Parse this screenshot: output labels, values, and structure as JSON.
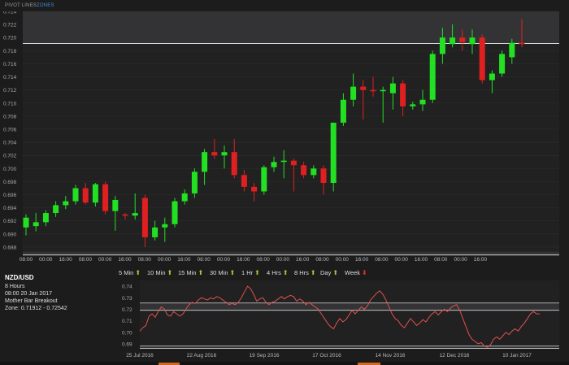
{
  "tabs": {
    "pivot_lines": "PIVOT LINES",
    "zones": "ZONES"
  },
  "info": {
    "pair": "NZD/USD",
    "interval": "8 Hours",
    "time": "08:00 20 Jan 2017",
    "pattern": "Mother Bar Breakout",
    "zone": "Zone: 0.71912 - 0.72542"
  },
  "timeframes": [
    {
      "label": "5 Min",
      "dir": "up"
    },
    {
      "label": "10 Min",
      "dir": "up"
    },
    {
      "label": "15 Min",
      "dir": "up"
    },
    {
      "label": "30 Min",
      "dir": "up"
    },
    {
      "label": "1 Hr",
      "dir": "up"
    },
    {
      "label": "4 Hrs",
      "dir": "up"
    },
    {
      "label": "8 Hrs",
      "dir": "up"
    },
    {
      "label": "Day",
      "dir": "up"
    },
    {
      "label": "Week",
      "dir": "down"
    }
  ],
  "colors": {
    "up": "#22e022",
    "down": "#e02020",
    "up_arrow": "#9acd32",
    "down_arrow": "#e03030",
    "line": "#e05050"
  },
  "chart_data": [
    {
      "type": "candlestick",
      "ylim": [
        0.687,
        0.724
      ],
      "y_ticks": [
        "0.688",
        "0.690",
        "0.692",
        "0.694",
        "0.696",
        "0.698",
        "0.700",
        "0.702",
        "0.704",
        "0.706",
        "0.708",
        "0.710",
        "0.712",
        "0.714",
        "0.716",
        "0.718",
        "0.720",
        "0.722",
        "0.724"
      ],
      "x_ticks": [
        "08:00",
        "00:00",
        "16:00",
        "08:00",
        "00:00",
        "16:00",
        "08:00",
        "00:00",
        "16:00",
        "08:00",
        "00:00",
        "16:00",
        "08:00",
        "00:00",
        "16:00",
        "08:00",
        "00:00",
        "16:00",
        "08:00",
        "00:00",
        "16:00",
        "08:00",
        "00:00",
        "16:00"
      ],
      "zones": [
        [
          0.7191,
          0.7245
        ],
        [
          0.6868,
          0.6873
        ]
      ],
      "candles": [
        {
          "o": 0.691,
          "h": 0.693,
          "l": 0.6898,
          "c": 0.6925
        },
        {
          "o": 0.6912,
          "h": 0.6932,
          "l": 0.6904,
          "c": 0.6918
        },
        {
          "o": 0.6918,
          "h": 0.6936,
          "l": 0.6912,
          "c": 0.6932
        },
        {
          "o": 0.6932,
          "h": 0.695,
          "l": 0.6926,
          "c": 0.6944
        },
        {
          "o": 0.6944,
          "h": 0.6958,
          "l": 0.6938,
          "c": 0.695
        },
        {
          "o": 0.695,
          "h": 0.6975,
          "l": 0.6945,
          "c": 0.697
        },
        {
          "o": 0.697,
          "h": 0.6978,
          "l": 0.6945,
          "c": 0.6948
        },
        {
          "o": 0.6948,
          "h": 0.6978,
          "l": 0.6942,
          "c": 0.6976
        },
        {
          "o": 0.6976,
          "h": 0.698,
          "l": 0.693,
          "c": 0.6935
        },
        {
          "o": 0.6935,
          "h": 0.6958,
          "l": 0.6905,
          "c": 0.6952
        },
        {
          "o": 0.693,
          "h": 0.6932,
          "l": 0.6922,
          "c": 0.6928
        },
        {
          "o": 0.6928,
          "h": 0.6962,
          "l": 0.6922,
          "c": 0.6932
        },
        {
          "o": 0.6955,
          "h": 0.696,
          "l": 0.688,
          "c": 0.6895
        },
        {
          "o": 0.6895,
          "h": 0.692,
          "l": 0.689,
          "c": 0.691
        },
        {
          "o": 0.691,
          "h": 0.6925,
          "l": 0.6888,
          "c": 0.6915
        },
        {
          "o": 0.6915,
          "h": 0.6955,
          "l": 0.691,
          "c": 0.695
        },
        {
          "o": 0.695,
          "h": 0.6968,
          "l": 0.6945,
          "c": 0.6962
        },
        {
          "o": 0.6962,
          "h": 0.7,
          "l": 0.6955,
          "c": 0.6995
        },
        {
          "o": 0.6995,
          "h": 0.703,
          "l": 0.6975,
          "c": 0.7025
        },
        {
          "o": 0.7025,
          "h": 0.7045,
          "l": 0.7015,
          "c": 0.702
        },
        {
          "o": 0.702,
          "h": 0.7035,
          "l": 0.7,
          "c": 0.7025
        },
        {
          "o": 0.7025,
          "h": 0.7045,
          "l": 0.6985,
          "c": 0.699
        },
        {
          "o": 0.699,
          "h": 0.6998,
          "l": 0.6965,
          "c": 0.6972
        },
        {
          "o": 0.6972,
          "h": 0.6978,
          "l": 0.695,
          "c": 0.6965
        },
        {
          "o": 0.6965,
          "h": 0.7005,
          "l": 0.696,
          "c": 0.7002
        },
        {
          "o": 0.7002,
          "h": 0.7018,
          "l": 0.6995,
          "c": 0.701
        },
        {
          "o": 0.701,
          "h": 0.7028,
          "l": 0.6985,
          "c": 0.7012
        },
        {
          "o": 0.7012,
          "h": 0.7015,
          "l": 0.6965,
          "c": 0.7005
        },
        {
          "o": 0.7005,
          "h": 0.701,
          "l": 0.6985,
          "c": 0.699
        },
        {
          "o": 0.699,
          "h": 0.7005,
          "l": 0.6985,
          "c": 0.7
        },
        {
          "o": 0.7,
          "h": 0.7005,
          "l": 0.696,
          "c": 0.6978
        },
        {
          "o": 0.6978,
          "h": 0.707,
          "l": 0.6965,
          "c": 0.707
        },
        {
          "o": 0.707,
          "h": 0.7115,
          "l": 0.7065,
          "c": 0.7105
        },
        {
          "o": 0.7105,
          "h": 0.7145,
          "l": 0.7095,
          "c": 0.7125
        },
        {
          "o": 0.7125,
          "h": 0.7135,
          "l": 0.7075,
          "c": 0.712
        },
        {
          "o": 0.712,
          "h": 0.714,
          "l": 0.711,
          "c": 0.7118
        },
        {
          "o": 0.7118,
          "h": 0.7125,
          "l": 0.707,
          "c": 0.712
        },
        {
          "o": 0.7115,
          "h": 0.714,
          "l": 0.709,
          "c": 0.713
        },
        {
          "o": 0.713,
          "h": 0.7135,
          "l": 0.708,
          "c": 0.7095
        },
        {
          "o": 0.7095,
          "h": 0.7102,
          "l": 0.709,
          "c": 0.7098
        },
        {
          "o": 0.7098,
          "h": 0.712,
          "l": 0.7088,
          "c": 0.7105
        },
        {
          "o": 0.7105,
          "h": 0.718,
          "l": 0.71,
          "c": 0.7175
        },
        {
          "o": 0.7175,
          "h": 0.7215,
          "l": 0.716,
          "c": 0.72
        },
        {
          "o": 0.719,
          "h": 0.722,
          "l": 0.7185,
          "c": 0.72
        },
        {
          "o": 0.72,
          "h": 0.7212,
          "l": 0.718,
          "c": 0.7193
        },
        {
          "o": 0.719,
          "h": 0.7212,
          "l": 0.7175,
          "c": 0.72
        },
        {
          "o": 0.72,
          "h": 0.7205,
          "l": 0.713,
          "c": 0.7135
        },
        {
          "o": 0.7135,
          "h": 0.715,
          "l": 0.7115,
          "c": 0.7145
        },
        {
          "o": 0.7145,
          "h": 0.718,
          "l": 0.714,
          "c": 0.7175
        },
        {
          "o": 0.717,
          "h": 0.7198,
          "l": 0.716,
          "c": 0.7192
        },
        {
          "o": 0.7192,
          "h": 0.7228,
          "l": 0.7185,
          "c": 0.719
        }
      ]
    },
    {
      "type": "line",
      "ylim": [
        0.685,
        0.745
      ],
      "y_ticks": [
        "0.74",
        "0.73",
        "0.72",
        "0.71",
        "0.70",
        "0.69"
      ],
      "x_ticks": [
        "25 Jul 2016",
        "22 Aug 2016",
        "19 Sep 2016",
        "17 Oct 2016",
        "14 Nov 2016",
        "12 Dec 2016",
        "10 Jan 2017"
      ],
      "zones": [
        [
          0.7191,
          0.7254
        ],
        [
          0.686,
          0.688
        ]
      ],
      "values": [
        0.701,
        0.704,
        0.706,
        0.714,
        0.716,
        0.713,
        0.718,
        0.722,
        0.72,
        0.715,
        0.714,
        0.718,
        0.716,
        0.714,
        0.716,
        0.72,
        0.724,
        0.726,
        0.725,
        0.728,
        0.73,
        0.729,
        0.728,
        0.73,
        0.729,
        0.731,
        0.73,
        0.728,
        0.726,
        0.724,
        0.725,
        0.724,
        0.726,
        0.73,
        0.735,
        0.74,
        0.738,
        0.733,
        0.727,
        0.729,
        0.73,
        0.726,
        0.724,
        0.726,
        0.727,
        0.729,
        0.731,
        0.729,
        0.731,
        0.732,
        0.731,
        0.727,
        0.729,
        0.727,
        0.724,
        0.726,
        0.724,
        0.722,
        0.72,
        0.716,
        0.712,
        0.708,
        0.705,
        0.703,
        0.708,
        0.712,
        0.709,
        0.711,
        0.715,
        0.719,
        0.716,
        0.719,
        0.722,
        0.72,
        0.723,
        0.728,
        0.731,
        0.734,
        0.736,
        0.733,
        0.728,
        0.722,
        0.716,
        0.712,
        0.71,
        0.706,
        0.704,
        0.708,
        0.712,
        0.709,
        0.706,
        0.708,
        0.711,
        0.709,
        0.713,
        0.716,
        0.718,
        0.715,
        0.718,
        0.72,
        0.718,
        0.721,
        0.723,
        0.724,
        0.719,
        0.712,
        0.705,
        0.698,
        0.694,
        0.692,
        0.69,
        0.691,
        0.688,
        0.687,
        0.689,
        0.694,
        0.696,
        0.694,
        0.697,
        0.7,
        0.698,
        0.701,
        0.703,
        0.701,
        0.705,
        0.708,
        0.712,
        0.716,
        0.718,
        0.716,
        0.716
      ]
    }
  ]
}
